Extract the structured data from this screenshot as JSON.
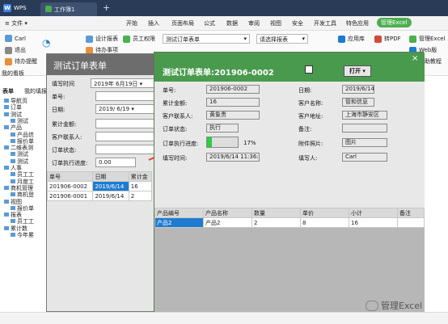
{
  "app": {
    "name": "WPS",
    "tab": "工作簿1",
    "plus": "+"
  },
  "menu": [
    "≡ 文件 ▾",
    "开始",
    "插入",
    "页面布局",
    "公式",
    "数据",
    "审阅",
    "视图",
    "安全",
    "开发工具",
    "特色应用",
    "管理Excel"
  ],
  "ribbon": {
    "left": [
      "Carl",
      "退出",
      "待办提醒"
    ],
    "mid": [
      "设计报表",
      "员工权限",
      "待办事项"
    ],
    "combo1": "测试订单表单",
    "combo2": "请选择报表",
    "right": [
      "应用库",
      "转PDF",
      "管理Excel",
      "Web版",
      "帮助教程"
    ]
  },
  "left_tabs": {
    "tab1": "表单",
    "tab2": "我的填报"
  },
  "my_board": "我的看板",
  "tree": [
    "导航页",
    "订单",
    "测试",
    "测试",
    "产品",
    "产品信",
    "报价单",
    "二维表测",
    "测试",
    "测试",
    "人事",
    "员工工",
    "月度工",
    "商机管理",
    "商机登",
    "视图",
    "报价单",
    "报表",
    "员工工",
    "累计数",
    "今年累"
  ],
  "form1": {
    "title": "测试订单表单",
    "fill_time_label": "填写时间",
    "fill_time_value": "2019年 6月19日",
    "order_no_label": "单号:",
    "date_label": "日期:",
    "date_value": "2019/ 6/19",
    "total_label": "累计金额:",
    "contact_label": "客户联系人:",
    "status_label": "订单状态:",
    "progress_label": "订单执行进度:",
    "progress_value": "0.00",
    "table": {
      "headers": [
        "单号",
        "日期",
        "累计金"
      ],
      "rows": [
        [
          "201906-0002",
          "2019/6/14",
          "16"
        ],
        [
          "201906-0001",
          "2019/6/14",
          "2"
        ]
      ]
    }
  },
  "dialog": {
    "title": "测试订单表单:201906-0002",
    "print_label": "打开",
    "close": "×",
    "fields": {
      "order_no": {
        "label": "单号:",
        "value": "201906-0002"
      },
      "date": {
        "label": "日期:",
        "value": "2019/6/14"
      },
      "total": {
        "label": "累计金额:",
        "value": "16"
      },
      "customer": {
        "label": "客户名称:",
        "value": "管和信息"
      },
      "contact": {
        "label": "客户联系人:",
        "value": "黄象贵"
      },
      "address": {
        "label": "客户地址:",
        "value": "上海市静安区"
      },
      "status": {
        "label": "订单状态:",
        "value": "执行"
      },
      "note": {
        "label": "备注:",
        "value": ""
      },
      "progress": {
        "label": "订单执行进度:",
        "value": "17%",
        "fraction": 0.17
      },
      "attachment": {
        "label": "附件照片:",
        "value": "图片"
      },
      "fill_time": {
        "label": "填写时间:",
        "value": "2019/6/14 11:36:58"
      },
      "filler": {
        "label": "填写人:",
        "value": "Carl"
      }
    },
    "detail": {
      "headers": [
        "产品编号",
        "产品名称",
        "数量",
        "单价",
        "小计",
        "备注"
      ],
      "rows": [
        [
          "产品2",
          "产品2",
          "2",
          "8",
          "16",
          ""
        ]
      ]
    }
  },
  "watermark": "管理Excel",
  "colors": {
    "accent": "#4a9a4e",
    "titlebar": "#2a3b57",
    "selection": "#1e7bd2"
  }
}
